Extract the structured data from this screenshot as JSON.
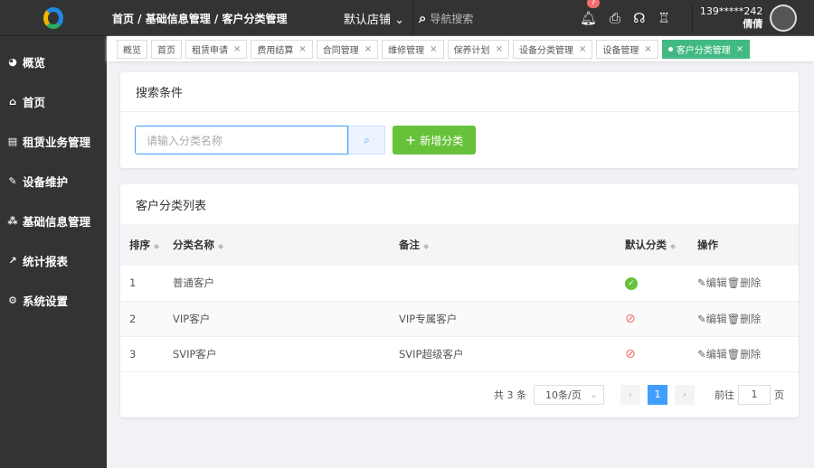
{
  "sidebar": {
    "items": [
      {
        "label": "概览",
        "icon": "pie-chart-icon"
      },
      {
        "label": "首页",
        "icon": "home-icon"
      },
      {
        "label": "租赁业务管理",
        "icon": "document-icon"
      },
      {
        "label": "设备维护",
        "icon": "wrench-icon"
      },
      {
        "label": "基础信息管理",
        "icon": "cluster-icon"
      },
      {
        "label": "统计报表",
        "icon": "line-chart-icon"
      },
      {
        "label": "系统设置",
        "icon": "gear-icon"
      }
    ]
  },
  "header": {
    "breadcrumb": "首页 / 基础信息管理 / 客户分类管理",
    "store": "默认店铺",
    "search_placeholder": "导航搜索",
    "notifications": "7",
    "phone": "139*****242",
    "username": "倩倩"
  },
  "tabs": [
    {
      "label": "概览"
    },
    {
      "label": "首页"
    },
    {
      "label": "租赁申请"
    },
    {
      "label": "费用结算"
    },
    {
      "label": "合同管理"
    },
    {
      "label": "维修管理"
    },
    {
      "label": "保养计划"
    },
    {
      "label": "设备分类管理"
    },
    {
      "label": "设备管理"
    },
    {
      "label": "客户分类管理"
    }
  ],
  "search": {
    "title": "搜索条件",
    "placeholder": "请输入分类名称",
    "add_label": "新增分类"
  },
  "list": {
    "title": "客户分类列表",
    "columns": [
      "排序",
      "分类名称",
      "备注",
      "默认分类",
      "操作"
    ],
    "rows": [
      {
        "order": "1",
        "name": "普通客户",
        "note": "",
        "default": true
      },
      {
        "order": "2",
        "name": "VIP客户",
        "note": "VIP专属客户",
        "default": false
      },
      {
        "order": "3",
        "name": "SVIP客户",
        "note": "SVIP超级客户",
        "default": false
      }
    ],
    "edit": "编辑",
    "delete": "删除"
  },
  "pagination": {
    "total": "共 3 条",
    "page_size": "10条/页",
    "current": "1",
    "goto_label": "前往",
    "goto_value": "1",
    "page_unit": "页"
  },
  "colors": {
    "accent": "#409eff",
    "success": "#67c23a",
    "active_tab": "#42b983",
    "danger": "#f56c6c"
  }
}
